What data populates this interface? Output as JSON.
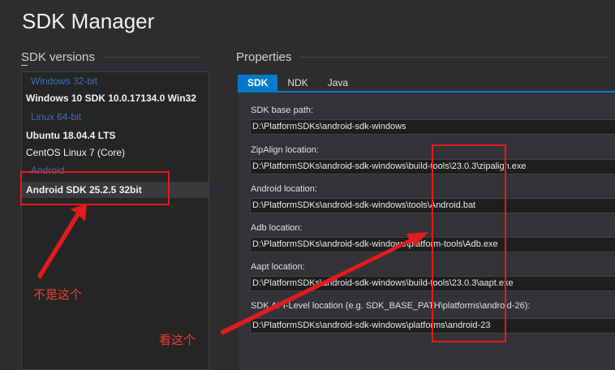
{
  "window": {
    "title": "SDK Manager"
  },
  "sdk_versions": {
    "header": "SDK versions",
    "groups": [
      {
        "label": "Windows 32-bit"
      },
      {
        "label": "Linux 64-bit"
      },
      {
        "label": "Android"
      }
    ],
    "items": [
      {
        "label": "Windows 10 SDK 10.0.17134.0 Win32"
      },
      {
        "label": "Ubuntu 18.04.4 LTS"
      },
      {
        "label": "CentOS Linux 7 (Core)"
      },
      {
        "label": "Android SDK 25.2.5 32bit",
        "selected": true
      }
    ]
  },
  "properties": {
    "header": "Properties",
    "tabs": [
      {
        "label": "SDK",
        "active": true
      },
      {
        "label": "NDK"
      },
      {
        "label": "Java"
      }
    ],
    "fields": [
      {
        "label": "SDK base path:",
        "value": "D:\\PlatformSDKs\\android-sdk-windows"
      },
      {
        "label": "ZipAlign location:",
        "value": "D:\\PlatformSDKs\\android-sdk-windows\\build-tools\\23.0.3\\zipalign.exe"
      },
      {
        "label": "Android location:",
        "value": "D:\\PlatformSDKs\\android-sdk-windows\\tools\\Android.bat"
      },
      {
        "label": "Adb location:",
        "value": "D:\\PlatformSDKs\\android-sdk-windows\\platform-tools\\Adb.exe"
      },
      {
        "label": "Aapt location:",
        "value": "D:\\PlatformSDKs\\android-sdk-windows\\build-tools\\23.0.3\\aapt.exe"
      },
      {
        "label": "SDK API-Level location (e.g. SDK_BASE_PATH\\platforms\\android-26):",
        "value": "D:\\PlatformSDKs\\android-sdk-windows\\platforms\\android-23"
      }
    ]
  },
  "annotations": {
    "not_this": "不是这个",
    "look_this": "看这个",
    "color": "#e21b1b"
  }
}
